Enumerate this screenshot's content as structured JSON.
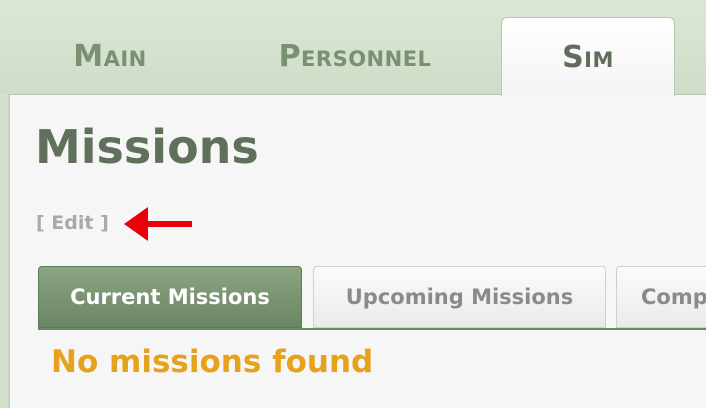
{
  "nav": {
    "tabs": [
      {
        "label": "Main",
        "active": false
      },
      {
        "label": "Personnel",
        "active": false
      },
      {
        "label": "Sim",
        "active": true
      }
    ]
  },
  "page": {
    "title": "Missions",
    "edit_link": "[ Edit ]"
  },
  "sub_tabs": [
    {
      "label": "Current Missions",
      "active": true
    },
    {
      "label": "Upcoming Missions",
      "active": false
    },
    {
      "label": "Comp",
      "active": false
    }
  ],
  "content": {
    "empty_message": "No missions found"
  },
  "colors": {
    "accent": "#6b8663",
    "warning": "#e6a21d",
    "annotation_arrow": "#e8000b"
  },
  "icons": {
    "annotation": "red-arrow-left-icon"
  }
}
